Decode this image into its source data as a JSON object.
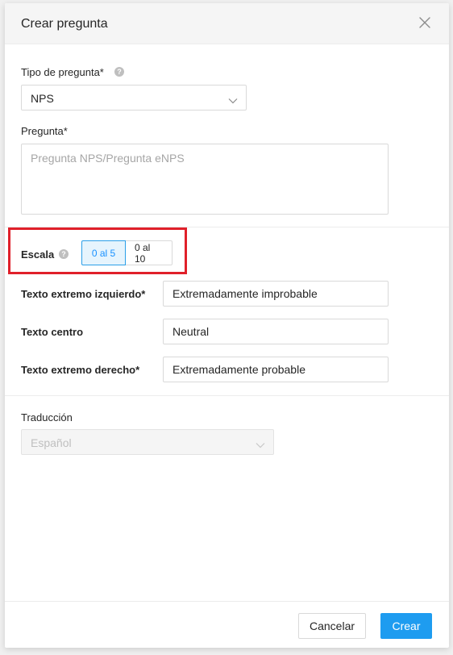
{
  "modal": {
    "title": "Crear pregunta",
    "close_icon": "close-icon"
  },
  "question_type": {
    "label": "Tipo de pregunta*",
    "help_icon": "question-circle-icon",
    "value": "NPS",
    "chevron_icon": "chevron-down-icon"
  },
  "question": {
    "label": "Pregunta*",
    "value": "",
    "placeholder": "Pregunta NPS/Pregunta eNPS"
  },
  "scale": {
    "label": "Escala",
    "help_icon": "question-circle-icon",
    "options": [
      {
        "label": "0 al 5",
        "selected": true
      },
      {
        "label": "0 al 10",
        "selected": false
      }
    ],
    "highlight_color": "#e0202a"
  },
  "extremes": {
    "left_label": "Texto extremo izquierdo*",
    "left_value": "Extremadamente improbable",
    "center_label": "Texto centro",
    "center_value": "Neutral",
    "right_label": "Texto extremo derecho*",
    "right_value": "Extremadamente probable"
  },
  "translation": {
    "label": "Traducción",
    "value": "Español",
    "disabled": true,
    "chevron_icon": "chevron-down-icon"
  },
  "footer": {
    "cancel_label": "Cancelar",
    "create_label": "Crear",
    "primary_color": "#1e9cf0"
  }
}
